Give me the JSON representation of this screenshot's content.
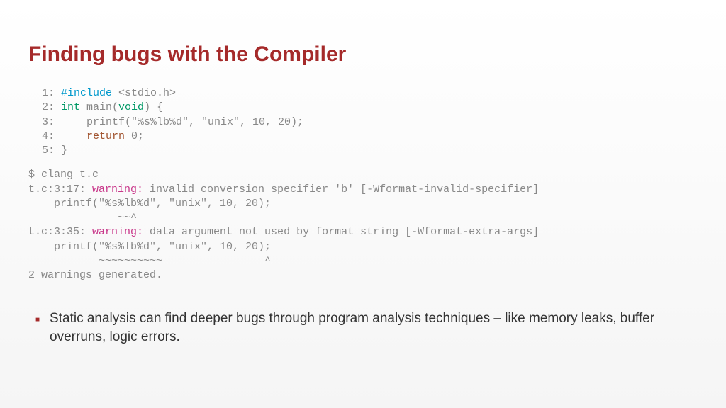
{
  "title": "Finding bugs with the Compiler",
  "code": {
    "l1_pre": " 1: ",
    "l1_include": "#include",
    "l1_rest": " <stdio.h>",
    "l2_pre": " 2: ",
    "l2_int": "int",
    "l2_mid1": " main(",
    "l2_void": "void",
    "l2_mid2": ") {",
    "l3": " 3:     printf(\"%s%lb%d\", \"unix\", 10, 20);",
    "l4_pre": " 4:     ",
    "l4_return": "return",
    "l4_rest": " 0;",
    "l5": " 5: }"
  },
  "output": {
    "cmd": "$ clang t.c",
    "w1_pre": "t.c:3:17: ",
    "w1_warn": "warning:",
    "w1_msg": " invalid conversion specifier 'b' [-Wformat-invalid-specifier]",
    "w1_code": "    printf(\"%s%lb%d\", \"unix\", 10, 20);",
    "w1_caret": "              ~~^",
    "w2_pre": "t.c:3:35: ",
    "w2_warn": "warning:",
    "w2_msg": " data argument not used by format string [-Wformat-extra-args]",
    "w2_code": "    printf(\"%s%lb%d\", \"unix\", 10, 20);",
    "w2_caret": "           ~~~~~~~~~~                ^",
    "summary": "2 warnings generated."
  },
  "bullet": "Static analysis can find deeper bugs through program analysis techniques – like memory leaks, buffer overruns, logic errors."
}
